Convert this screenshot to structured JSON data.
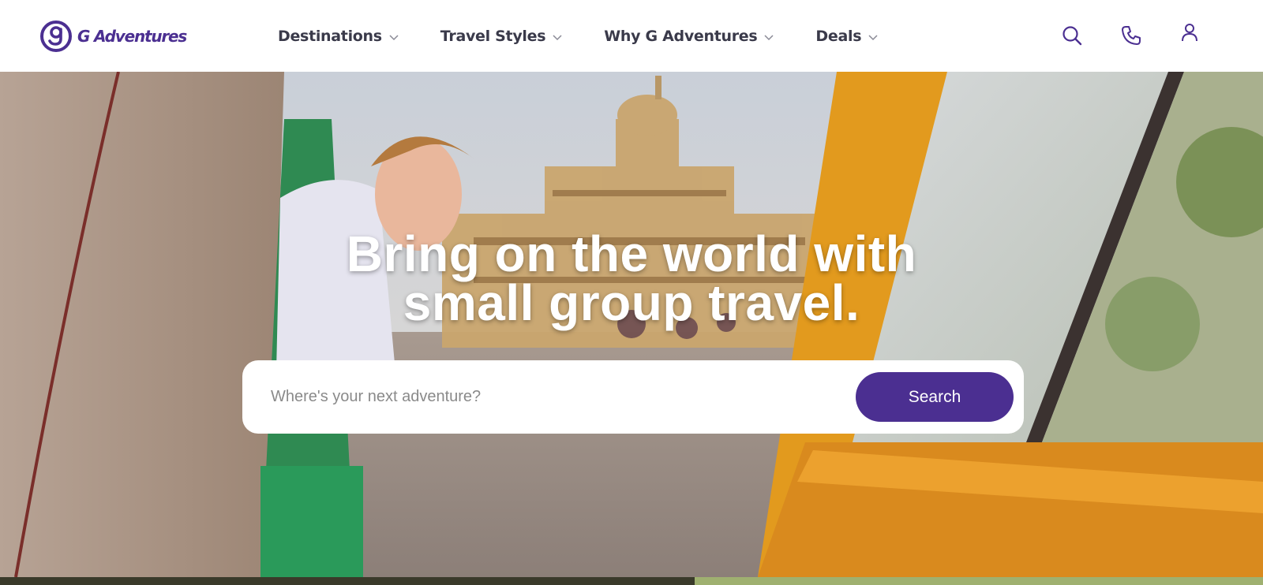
{
  "brand": {
    "name": "G Adventures",
    "accent_color": "#4b2f91",
    "logo_icon": "g-adventures-logo-icon"
  },
  "nav": {
    "items": [
      {
        "label": "Destinations",
        "icon": "chevron-down-icon"
      },
      {
        "label": "Travel Styles",
        "icon": "chevron-down-icon"
      },
      {
        "label": "Why G Adventures",
        "icon": "chevron-down-icon"
      },
      {
        "label": "Deals",
        "icon": "chevron-down-icon"
      }
    ],
    "utility_icons": [
      "search-icon",
      "phone-icon",
      "user-account-icon"
    ]
  },
  "hero": {
    "title_line1": "Bring on the world with",
    "title_line2": "small group travel.",
    "search": {
      "placeholder": "Where's your next adventure?",
      "value": "",
      "button_label": "Search"
    }
  }
}
